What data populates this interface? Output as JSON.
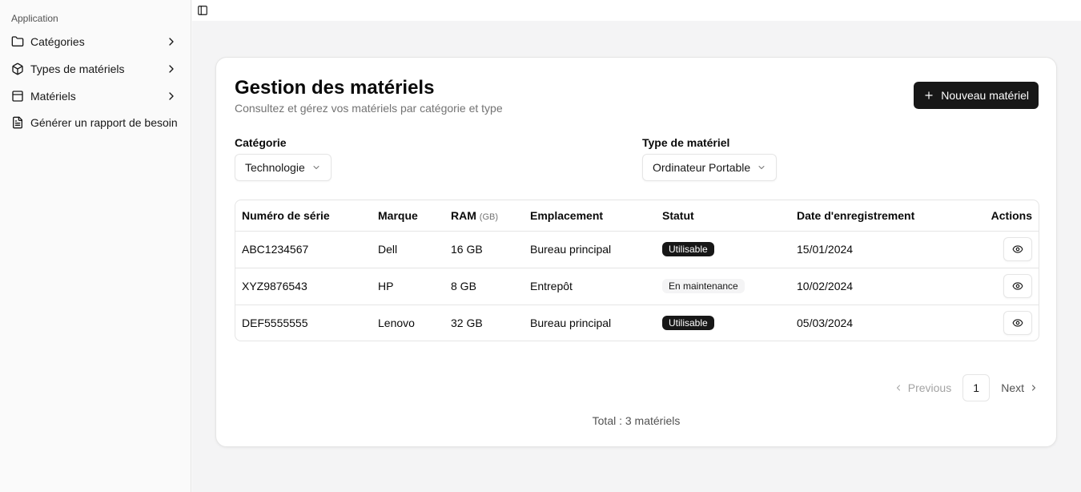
{
  "sidebar": {
    "group_label": "Application",
    "items": [
      {
        "label": "Catégories",
        "icon": "folder-icon",
        "has_submenu": true
      },
      {
        "label": "Types de matériels",
        "icon": "package-icon",
        "has_submenu": true
      },
      {
        "label": "Matériels",
        "icon": "layout-icon",
        "has_submenu": true
      },
      {
        "label": "Générer un rapport de besoin",
        "icon": "file-text-icon",
        "has_submenu": false
      }
    ]
  },
  "topbar": {
    "toggle_icon": "sidebar-toggle-icon"
  },
  "header": {
    "title": "Gestion des matériels",
    "subtitle": "Consultez et gérez vos matériels par catégorie et type",
    "new_button_label": "Nouveau matériel"
  },
  "filters": {
    "category": {
      "label": "Catégorie",
      "value": "Technologie"
    },
    "type": {
      "label": "Type de matériel",
      "value": "Ordinateur Portable"
    }
  },
  "table": {
    "headers": {
      "serial": "Numéro de série",
      "brand": "Marque",
      "ram": "RAM",
      "ram_unit": "(GB)",
      "location": "Emplacement",
      "status": "Statut",
      "date": "Date d'enregistrement",
      "actions": "Actions"
    },
    "rows": [
      {
        "serial": "ABC1234567",
        "brand": "Dell",
        "ram": "16 GB",
        "location": "Bureau principal",
        "status": "Utilisable",
        "status_style": "solid",
        "date": "15/01/2024"
      },
      {
        "serial": "XYZ9876543",
        "brand": "HP",
        "ram": "8 GB",
        "location": "Entrepôt",
        "status": "En maintenance",
        "status_style": "muted",
        "date": "10/02/2024"
      },
      {
        "serial": "DEF5555555",
        "brand": "Lenovo",
        "ram": "32 GB",
        "location": "Bureau principal",
        "status": "Utilisable",
        "status_style": "solid",
        "date": "05/03/2024"
      }
    ]
  },
  "pagination": {
    "previous": "Previous",
    "current_page": "1",
    "next": "Next"
  },
  "footer": {
    "total": "Total : 3 matériels"
  },
  "colors": {
    "primary": "#171717",
    "background": "#f4f4f5",
    "border": "#e5e5e5",
    "muted_text": "#737373"
  }
}
